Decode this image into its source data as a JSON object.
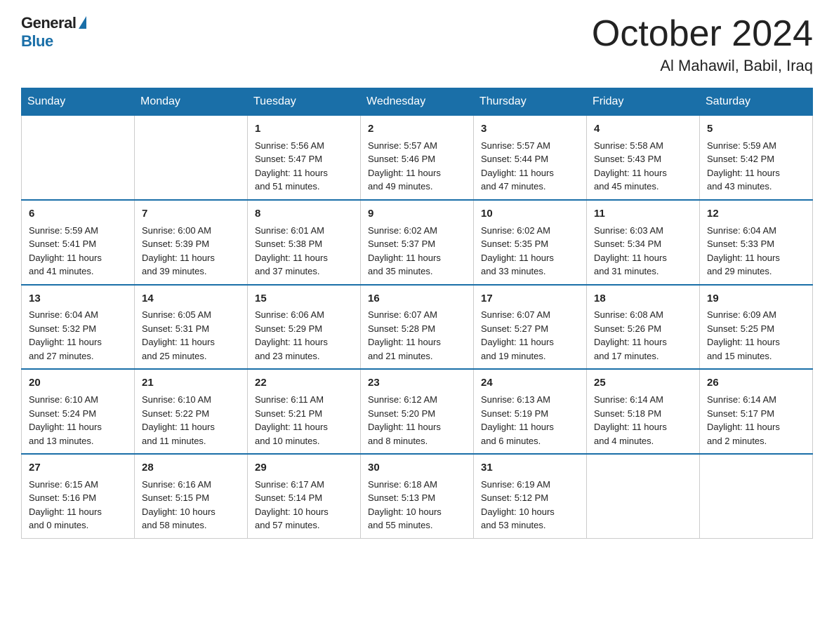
{
  "logo": {
    "general": "General",
    "blue": "Blue"
  },
  "title": "October 2024",
  "subtitle": "Al Mahawil, Babil, Iraq",
  "days_of_week": [
    "Sunday",
    "Monday",
    "Tuesday",
    "Wednesday",
    "Thursday",
    "Friday",
    "Saturday"
  ],
  "weeks": [
    [
      {
        "day": "",
        "info": ""
      },
      {
        "day": "",
        "info": ""
      },
      {
        "day": "1",
        "info": "Sunrise: 5:56 AM\nSunset: 5:47 PM\nDaylight: 11 hours\nand 51 minutes."
      },
      {
        "day": "2",
        "info": "Sunrise: 5:57 AM\nSunset: 5:46 PM\nDaylight: 11 hours\nand 49 minutes."
      },
      {
        "day": "3",
        "info": "Sunrise: 5:57 AM\nSunset: 5:44 PM\nDaylight: 11 hours\nand 47 minutes."
      },
      {
        "day": "4",
        "info": "Sunrise: 5:58 AM\nSunset: 5:43 PM\nDaylight: 11 hours\nand 45 minutes."
      },
      {
        "day": "5",
        "info": "Sunrise: 5:59 AM\nSunset: 5:42 PM\nDaylight: 11 hours\nand 43 minutes."
      }
    ],
    [
      {
        "day": "6",
        "info": "Sunrise: 5:59 AM\nSunset: 5:41 PM\nDaylight: 11 hours\nand 41 minutes."
      },
      {
        "day": "7",
        "info": "Sunrise: 6:00 AM\nSunset: 5:39 PM\nDaylight: 11 hours\nand 39 minutes."
      },
      {
        "day": "8",
        "info": "Sunrise: 6:01 AM\nSunset: 5:38 PM\nDaylight: 11 hours\nand 37 minutes."
      },
      {
        "day": "9",
        "info": "Sunrise: 6:02 AM\nSunset: 5:37 PM\nDaylight: 11 hours\nand 35 minutes."
      },
      {
        "day": "10",
        "info": "Sunrise: 6:02 AM\nSunset: 5:35 PM\nDaylight: 11 hours\nand 33 minutes."
      },
      {
        "day": "11",
        "info": "Sunrise: 6:03 AM\nSunset: 5:34 PM\nDaylight: 11 hours\nand 31 minutes."
      },
      {
        "day": "12",
        "info": "Sunrise: 6:04 AM\nSunset: 5:33 PM\nDaylight: 11 hours\nand 29 minutes."
      }
    ],
    [
      {
        "day": "13",
        "info": "Sunrise: 6:04 AM\nSunset: 5:32 PM\nDaylight: 11 hours\nand 27 minutes."
      },
      {
        "day": "14",
        "info": "Sunrise: 6:05 AM\nSunset: 5:31 PM\nDaylight: 11 hours\nand 25 minutes."
      },
      {
        "day": "15",
        "info": "Sunrise: 6:06 AM\nSunset: 5:29 PM\nDaylight: 11 hours\nand 23 minutes."
      },
      {
        "day": "16",
        "info": "Sunrise: 6:07 AM\nSunset: 5:28 PM\nDaylight: 11 hours\nand 21 minutes."
      },
      {
        "day": "17",
        "info": "Sunrise: 6:07 AM\nSunset: 5:27 PM\nDaylight: 11 hours\nand 19 minutes."
      },
      {
        "day": "18",
        "info": "Sunrise: 6:08 AM\nSunset: 5:26 PM\nDaylight: 11 hours\nand 17 minutes."
      },
      {
        "day": "19",
        "info": "Sunrise: 6:09 AM\nSunset: 5:25 PM\nDaylight: 11 hours\nand 15 minutes."
      }
    ],
    [
      {
        "day": "20",
        "info": "Sunrise: 6:10 AM\nSunset: 5:24 PM\nDaylight: 11 hours\nand 13 minutes."
      },
      {
        "day": "21",
        "info": "Sunrise: 6:10 AM\nSunset: 5:22 PM\nDaylight: 11 hours\nand 11 minutes."
      },
      {
        "day": "22",
        "info": "Sunrise: 6:11 AM\nSunset: 5:21 PM\nDaylight: 11 hours\nand 10 minutes."
      },
      {
        "day": "23",
        "info": "Sunrise: 6:12 AM\nSunset: 5:20 PM\nDaylight: 11 hours\nand 8 minutes."
      },
      {
        "day": "24",
        "info": "Sunrise: 6:13 AM\nSunset: 5:19 PM\nDaylight: 11 hours\nand 6 minutes."
      },
      {
        "day": "25",
        "info": "Sunrise: 6:14 AM\nSunset: 5:18 PM\nDaylight: 11 hours\nand 4 minutes."
      },
      {
        "day": "26",
        "info": "Sunrise: 6:14 AM\nSunset: 5:17 PM\nDaylight: 11 hours\nand 2 minutes."
      }
    ],
    [
      {
        "day": "27",
        "info": "Sunrise: 6:15 AM\nSunset: 5:16 PM\nDaylight: 11 hours\nand 0 minutes."
      },
      {
        "day": "28",
        "info": "Sunrise: 6:16 AM\nSunset: 5:15 PM\nDaylight: 10 hours\nand 58 minutes."
      },
      {
        "day": "29",
        "info": "Sunrise: 6:17 AM\nSunset: 5:14 PM\nDaylight: 10 hours\nand 57 minutes."
      },
      {
        "day": "30",
        "info": "Sunrise: 6:18 AM\nSunset: 5:13 PM\nDaylight: 10 hours\nand 55 minutes."
      },
      {
        "day": "31",
        "info": "Sunrise: 6:19 AM\nSunset: 5:12 PM\nDaylight: 10 hours\nand 53 minutes."
      },
      {
        "day": "",
        "info": ""
      },
      {
        "day": "",
        "info": ""
      }
    ]
  ]
}
